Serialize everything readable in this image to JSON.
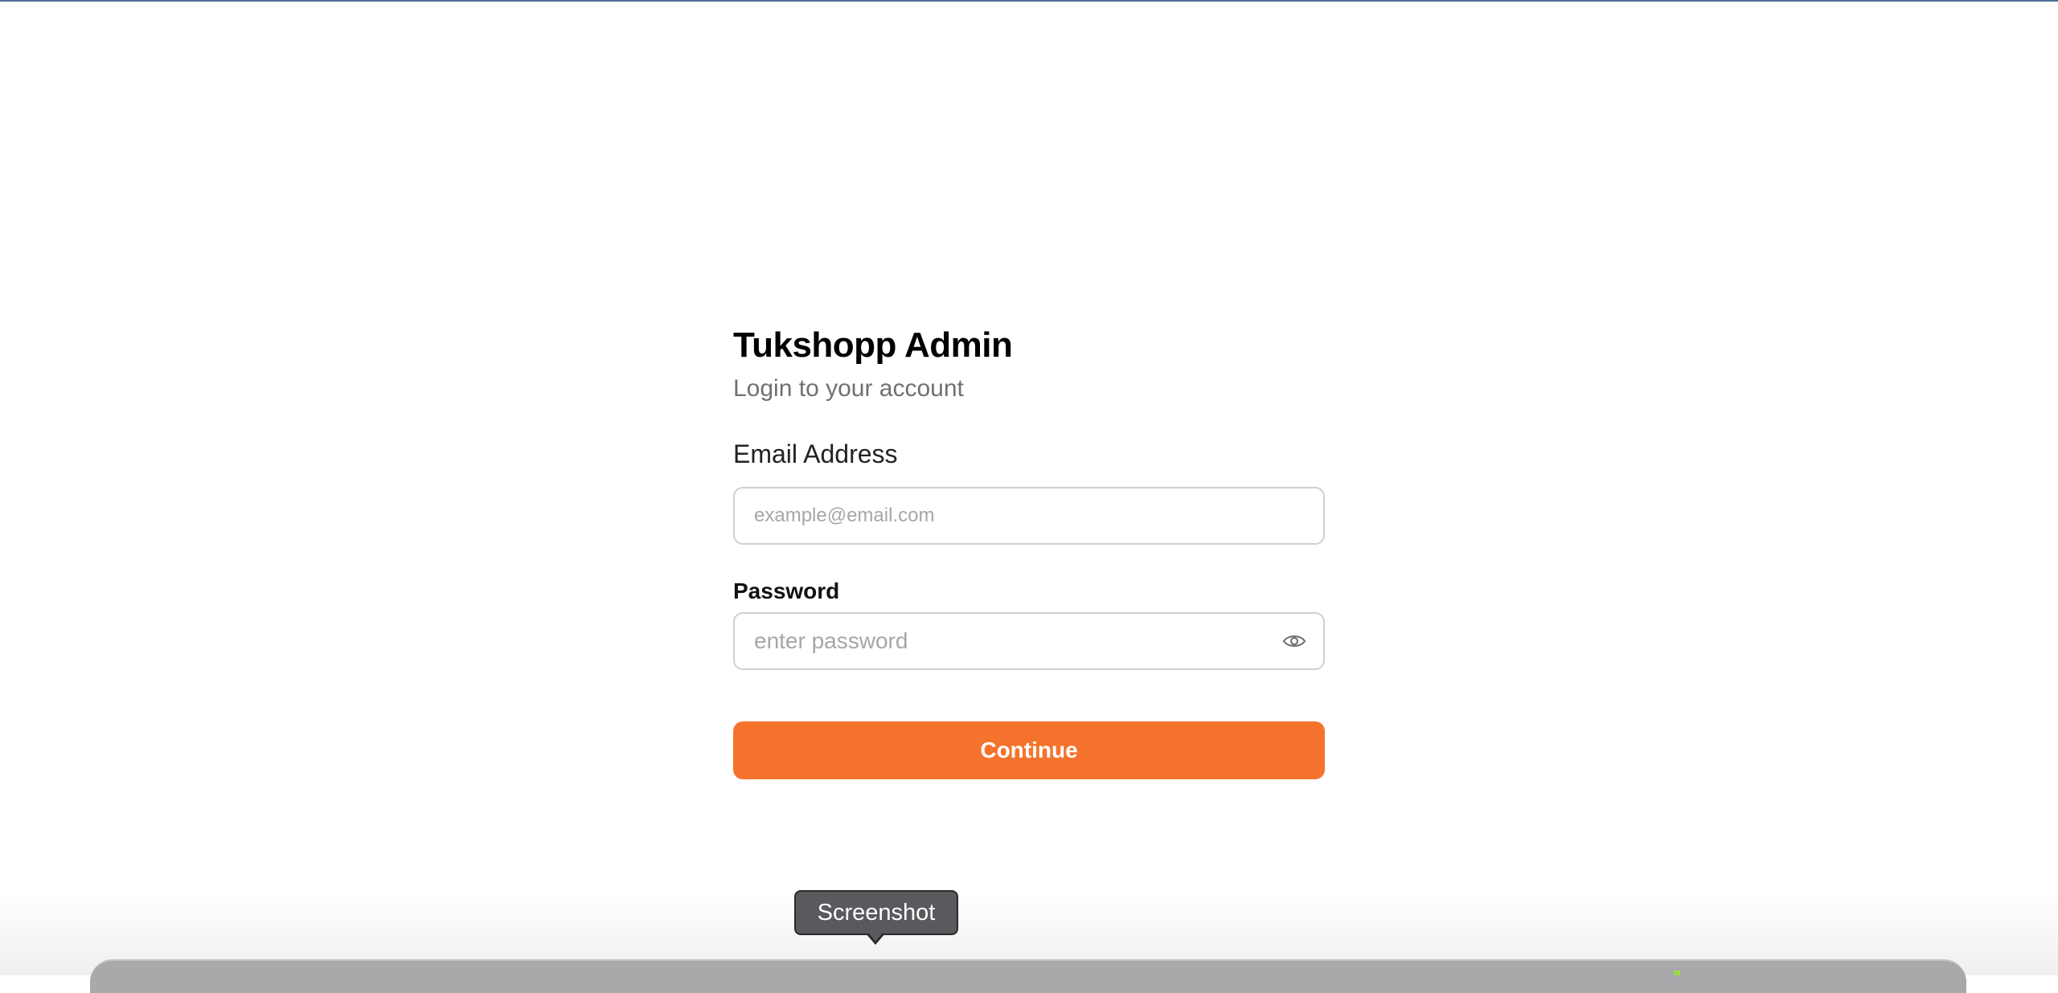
{
  "app": {
    "title": "Tukshopp Admin",
    "subtitle": "Login to your account"
  },
  "form": {
    "email_label": "Email Address",
    "email_placeholder": "example@email.com",
    "email_value": "",
    "password_label": "Password",
    "password_placeholder": "enter password",
    "password_value": "",
    "password_toggle_icon": "eye-icon",
    "submit_label": "Continue"
  },
  "tooltip": {
    "text": "Screenshot"
  },
  "colors": {
    "accent": "#f5732d",
    "top_line": "#4a6f91",
    "tooltip_bg": "#5a5a5e"
  }
}
